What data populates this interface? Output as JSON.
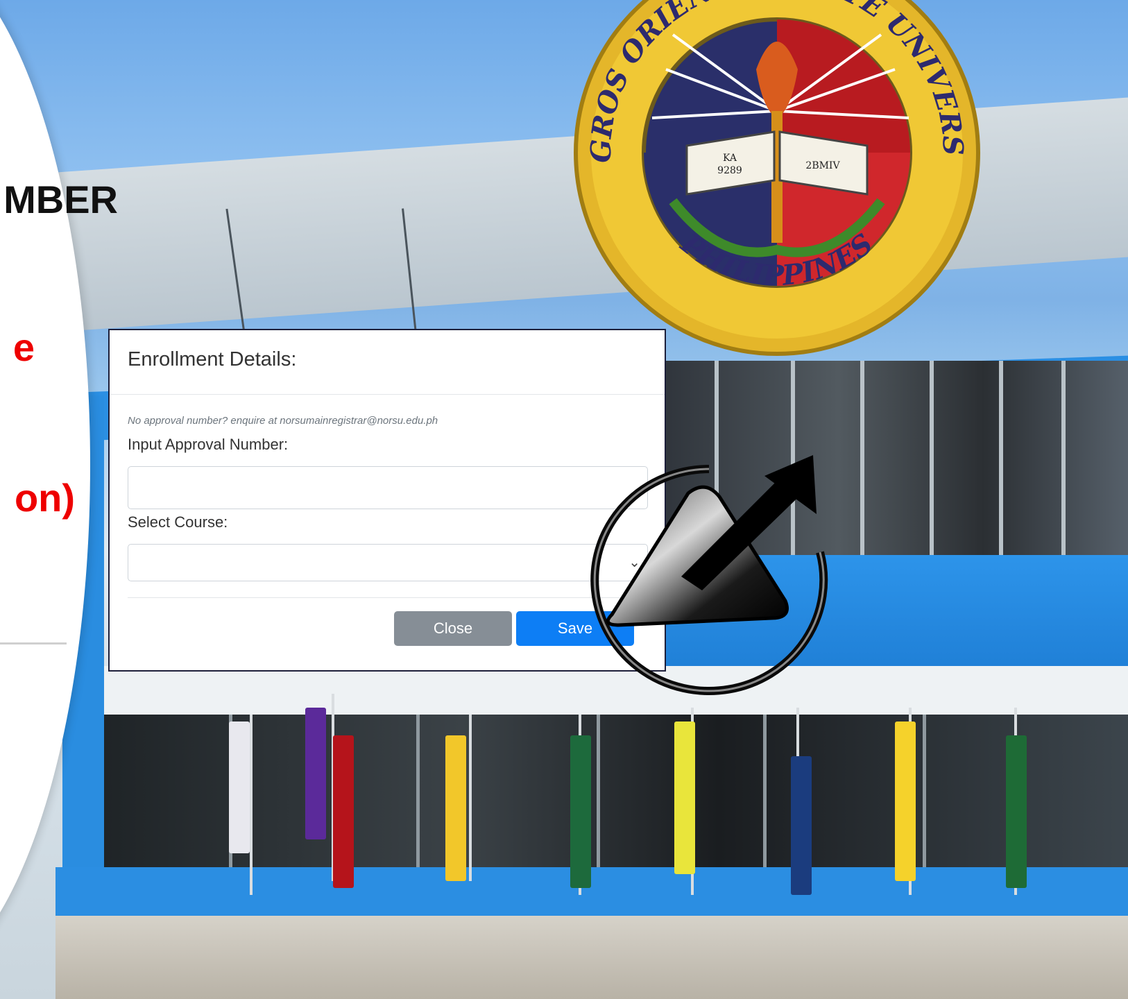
{
  "slide": {
    "heading_fragment": "MBER",
    "red_fragment_1": "e",
    "red_fragment_2": "on)"
  },
  "seal": {
    "outer_text": "NEGROS ORIENTAL STATE UNIVERSITY",
    "bottom_text": "PHILIPPINES",
    "book_left": "KA\n9289",
    "book_right": "2BMIV"
  },
  "modal": {
    "title": "Enrollment Details:",
    "note": "No approval number? enquire at norsumainregistrar@norsu.edu.ph",
    "approval_label": "Input Approval Number:",
    "approval_value": "",
    "course_label": "Select Course:",
    "course_value": "",
    "close_label": "Close",
    "save_label": "Save"
  },
  "colors": {
    "accent_blue": "#0d7ef5",
    "close_gray": "#868e96",
    "slide_red": "#ee0000",
    "building_blue": "#2b8fe3"
  },
  "icons": {
    "overlay": "refresh-arrow-icon",
    "select_chevron": "chevron-down-icon"
  }
}
